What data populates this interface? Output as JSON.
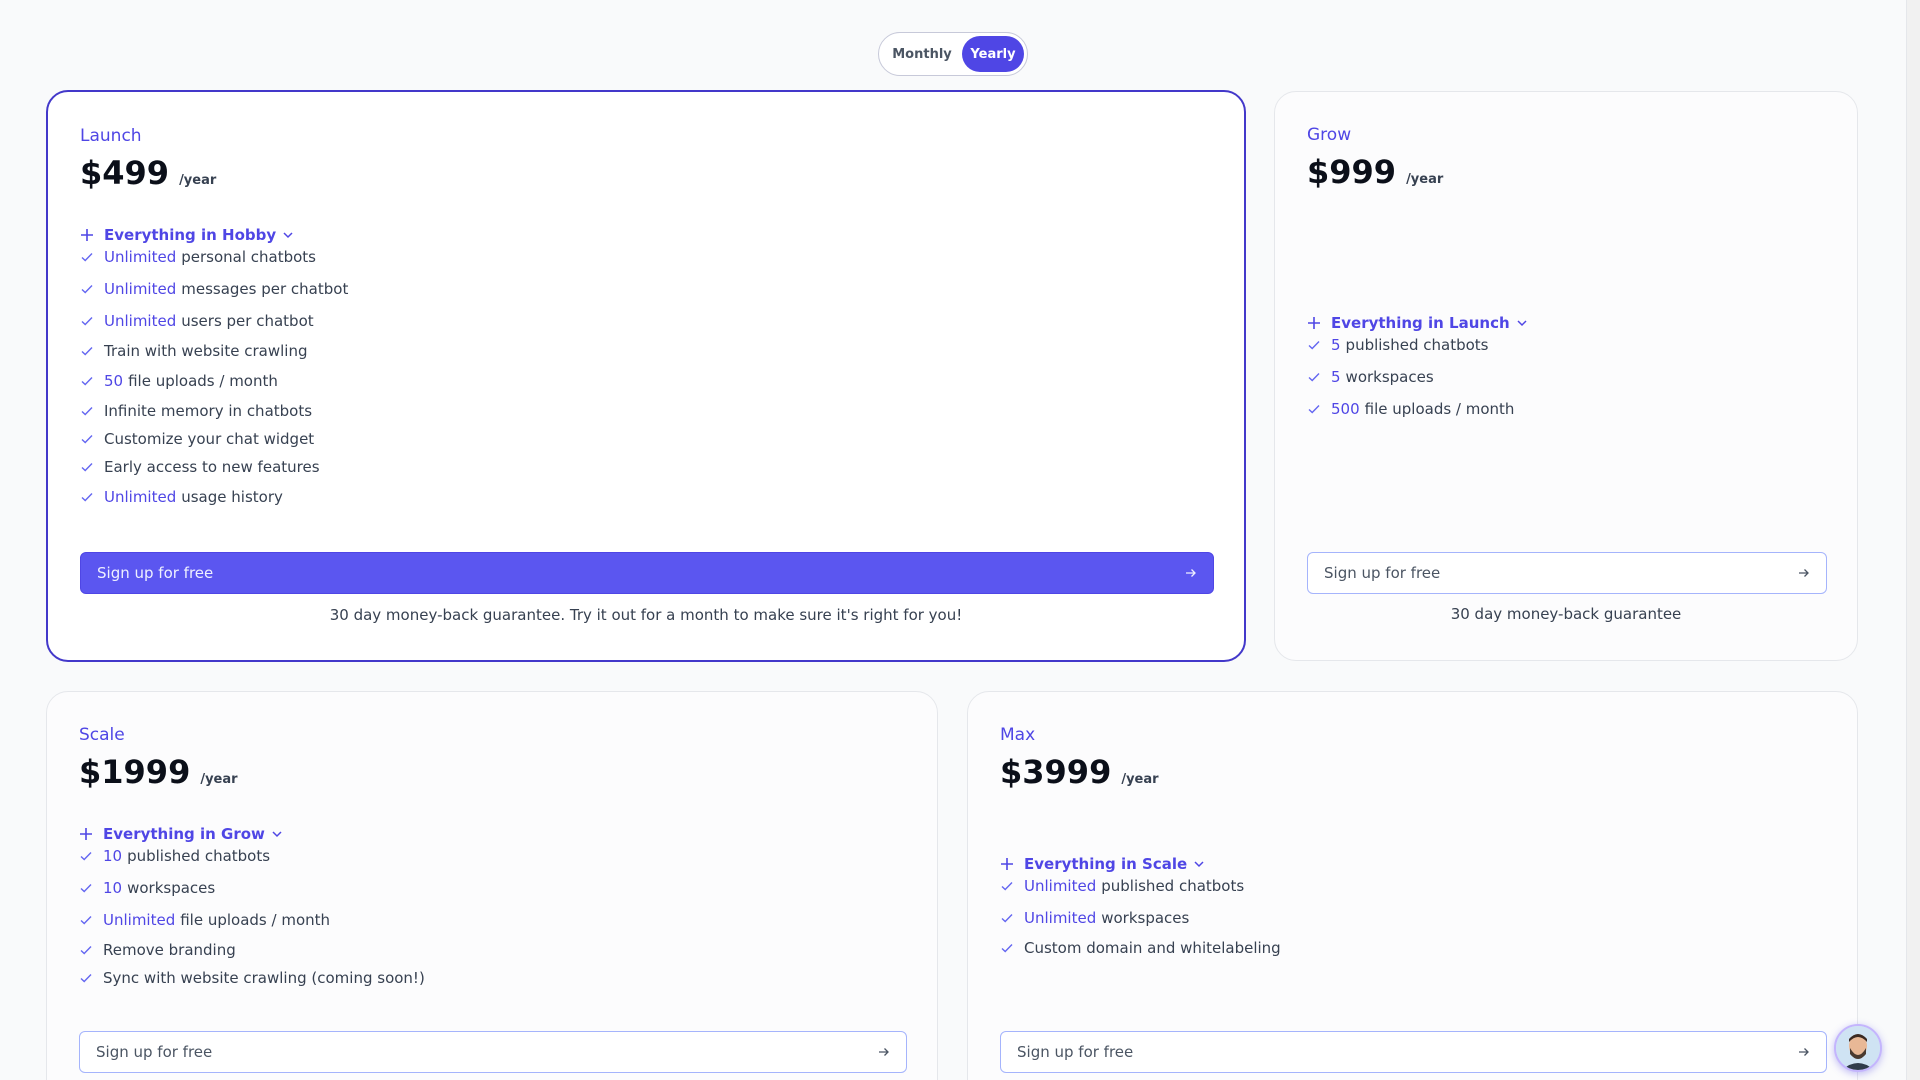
{
  "billing_toggle": {
    "monthly": "Monthly",
    "yearly": "Yearly",
    "selected": "Yearly"
  },
  "plans": [
    {
      "name": "Launch",
      "price": "$499",
      "per": "/year",
      "includes": "Everything in Hobby",
      "features": [
        {
          "highlight": "Unlimited",
          "text": "personal chatbots"
        },
        {
          "highlight": "Unlimited",
          "text": "messages per chatbot"
        },
        {
          "highlight": "Unlimited",
          "text": "users per chatbot"
        },
        {
          "highlight": "",
          "text": "Train with website crawling"
        },
        {
          "highlight": "50",
          "text": "file uploads / month"
        },
        {
          "highlight": "",
          "text": "Infinite memory in chatbots"
        },
        {
          "highlight": "",
          "text": "Customize your chat widget"
        },
        {
          "highlight": "",
          "text": "Early access to new features"
        },
        {
          "highlight": "Unlimited",
          "text": "usage history"
        }
      ],
      "cta": "Sign up for free",
      "guarantee": "30 day money-back guarantee. Try it out for a month to make sure it's right for you!"
    },
    {
      "name": "Grow",
      "price": "$999",
      "per": "/year",
      "includes": "Everything in Launch",
      "features": [
        {
          "highlight": "5",
          "text": "published chatbots"
        },
        {
          "highlight": "5",
          "text": "workspaces"
        },
        {
          "highlight": "500",
          "text": "file uploads / month"
        }
      ],
      "cta": "Sign up for free",
      "guarantee": "30 day money-back guarantee"
    },
    {
      "name": "Scale",
      "price": "$1999",
      "per": "/year",
      "includes": "Everything in Grow",
      "features": [
        {
          "highlight": "10",
          "text": "published chatbots"
        },
        {
          "highlight": "10",
          "text": "workspaces"
        },
        {
          "highlight": "Unlimited",
          "text": "file uploads / month"
        },
        {
          "highlight": "",
          "text": "Remove branding"
        },
        {
          "highlight": "",
          "text": "Sync with website crawling (coming soon!)"
        }
      ],
      "cta": "Sign up for free"
    },
    {
      "name": "Max",
      "price": "$3999",
      "per": "/year",
      "includes": "Everything in Scale",
      "features": [
        {
          "highlight": "Unlimited",
          "text": "published chatbots"
        },
        {
          "highlight": "Unlimited",
          "text": "workspaces"
        },
        {
          "highlight": "",
          "text": "Custom domain and whitelabeling"
        }
      ],
      "cta": "Sign up for free"
    }
  ],
  "icons": {
    "feature": "check-icon",
    "includes": "plus-icon",
    "expand": "chevron-down-icon",
    "cta": "arrow-right-icon",
    "chat": "support-avatar"
  },
  "colors": {
    "accent": "#4f46e5",
    "accent_border": "#4338ca"
  }
}
